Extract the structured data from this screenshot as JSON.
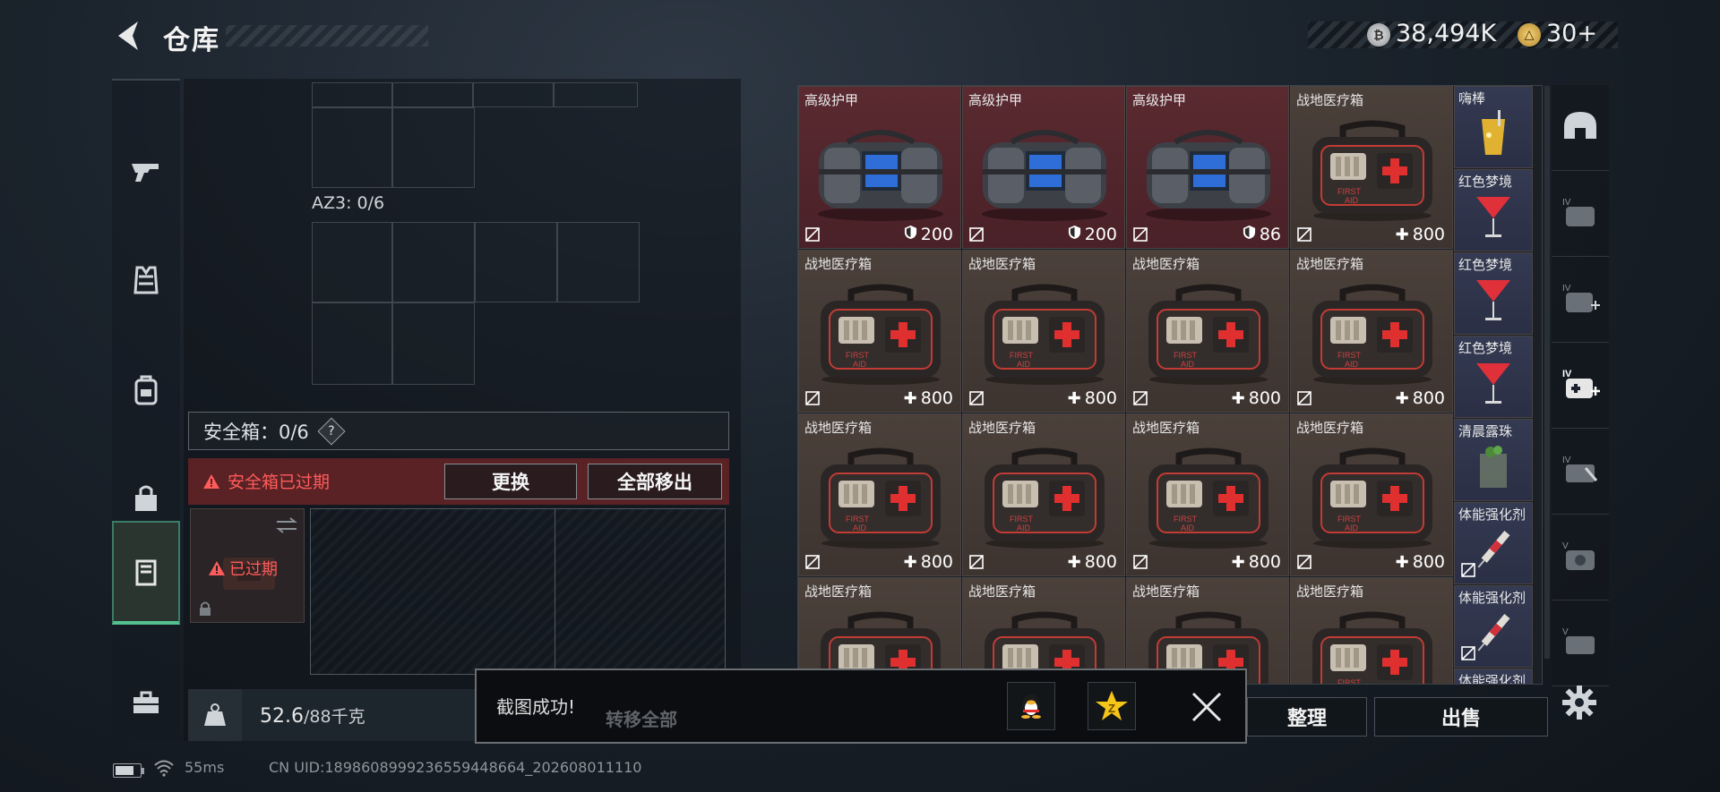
{
  "header": {
    "title": "仓库",
    "money": "38,494K",
    "gold_value": "30",
    "gold_plus": "+",
    "silver_icon_label": "₿",
    "gold_icon_label": "△"
  },
  "left_nav": {
    "items": [
      {
        "name": "pistol-icon"
      },
      {
        "name": "vest-icon"
      },
      {
        "name": "backpack-icon"
      },
      {
        "name": "bag-icon"
      },
      {
        "name": "safe-box-icon",
        "active": true
      },
      {
        "name": "toolbox-icon"
      }
    ]
  },
  "left_panel": {
    "az3_label": "AZ3: 0/6",
    "safe_label": "安全箱：0/6",
    "help_label": "?",
    "expired_warning": "安全箱已过期",
    "replace_button": "更换",
    "remove_all_button": "全部移出",
    "slot_expired": "已过期",
    "weight_current": "52.6",
    "weight_max": "/88千克"
  },
  "inventory": {
    "rows": [
      [
        {
          "name": "高级护甲",
          "stat": "200",
          "kind": "armor"
        },
        {
          "name": "高级护甲",
          "stat": "200",
          "kind": "armor"
        },
        {
          "name": "高级护甲",
          "stat": "86",
          "kind": "armor"
        },
        {
          "name": "战地医疗箱",
          "stat": "800",
          "kind": "medkit"
        }
      ],
      [
        {
          "name": "战地医疗箱",
          "stat": "800",
          "kind": "medkit"
        },
        {
          "name": "战地医疗箱",
          "stat": "800",
          "kind": "medkit"
        },
        {
          "name": "战地医疗箱",
          "stat": "800",
          "kind": "medkit"
        },
        {
          "name": "战地医疗箱",
          "stat": "800",
          "kind": "medkit"
        }
      ],
      [
        {
          "name": "战地医疗箱",
          "stat": "800",
          "kind": "medkit"
        },
        {
          "name": "战地医疗箱",
          "stat": "800",
          "kind": "medkit"
        },
        {
          "name": "战地医疗箱",
          "stat": "800",
          "kind": "medkit"
        },
        {
          "name": "战地医疗箱",
          "stat": "800",
          "kind": "medkit"
        }
      ],
      [
        {
          "name": "战地医疗箱",
          "stat": "",
          "kind": "medkit"
        },
        {
          "name": "战地医疗箱",
          "stat": "",
          "kind": "medkit"
        },
        {
          "name": "战地医疗箱",
          "stat": "",
          "kind": "medkit"
        },
        {
          "name": "战地医疗箱",
          "stat": "",
          "kind": "medkit"
        }
      ]
    ],
    "side_items": [
      {
        "name": "嗨棒",
        "kind": "drink"
      },
      {
        "name": "红色梦境",
        "kind": "cocktail"
      },
      {
        "name": "红色梦境",
        "kind": "cocktail"
      },
      {
        "name": "红色梦境",
        "kind": "cocktail"
      },
      {
        "name": "清晨露珠",
        "kind": "glass"
      },
      {
        "name": "体能强化剂",
        "kind": "syringe"
      },
      {
        "name": "体能强化剂",
        "kind": "syringe"
      },
      {
        "name": "体能强化剂",
        "kind": "syringe"
      }
    ],
    "plus_symbol": "✚"
  },
  "right_strip": {
    "items": [
      "helmet-icon",
      "armor-iv-icon",
      "medkit-iv-icon",
      "medkit-iv-selected-icon",
      "gear-iv-icon",
      "armor-v-icon",
      "gear-v-icon"
    ]
  },
  "bottom_buttons": {
    "sort": "整理",
    "sell": "出售"
  },
  "toast": {
    "message": "截图成功!",
    "ghost_text": "转移全部",
    "qq_label": "QQ",
    "qzone_label": "Z"
  },
  "status_bar": {
    "ping": "55ms",
    "uid": "CN UID:1898608999236559448664_202608011110",
    "battery_level": 0.7
  },
  "colors": {
    "accent_green": "#55c08f",
    "expired_red": "#ff5b5b",
    "armor_cell": "#5a2a30",
    "medkit_cell": "#4b403a",
    "side_cell": "#343a52"
  }
}
